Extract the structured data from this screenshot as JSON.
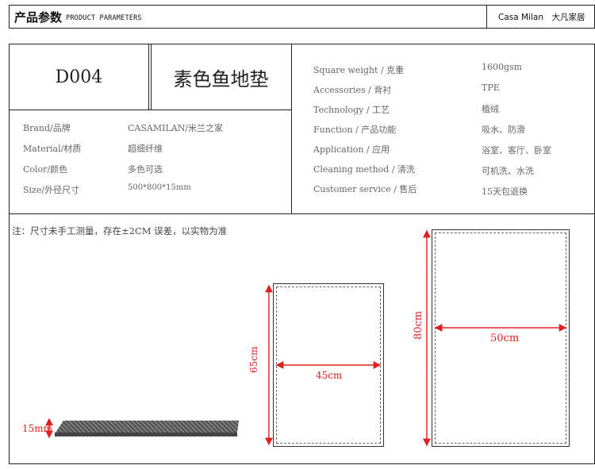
{
  "header": {
    "title_zh": "产品参数",
    "title_en": "PRODUCT PARAMETERS",
    "brand": "Casa Milan　大凡家居"
  },
  "product": {
    "code": "D004",
    "name": "素色鱼地垫"
  },
  "left_specs": [
    {
      "label": "Brand/品牌",
      "value": "CASAMILAN/米兰之家"
    },
    {
      "label": "Material/材质",
      "value": "超细纤维"
    },
    {
      "label": "Color/颜色",
      "value": "多色可选"
    },
    {
      "label": "Size/外径尺寸",
      "value": "500*800*15mm"
    }
  ],
  "right_specs": [
    {
      "label": "Square weight / 克重",
      "value": "1600gsm"
    },
    {
      "label": "Accessories / 背衬",
      "value": "TPE"
    },
    {
      "label": "Technology / 工艺",
      "value": "植绒"
    },
    {
      "label": "Function / 产品功能",
      "value": "吸水、防滑"
    },
    {
      "label": "Application / 应用",
      "value": "浴室、客厅、卧室"
    },
    {
      "label": "Cleaning method / 清洗",
      "value": "可机洗、水洗"
    },
    {
      "label": "Customer service /  售后",
      "value": "15天包退换"
    }
  ],
  "note": "注：尺寸未手工测量，存在±2CM 误差，以实物为准",
  "dimensions": {
    "thickness": "15mm",
    "small_width": "45cm",
    "small_height": "65cm",
    "large_width": "50cm",
    "large_height": "80cm"
  },
  "colors": {
    "dimension_red": "#e02020",
    "border": "#222222"
  }
}
